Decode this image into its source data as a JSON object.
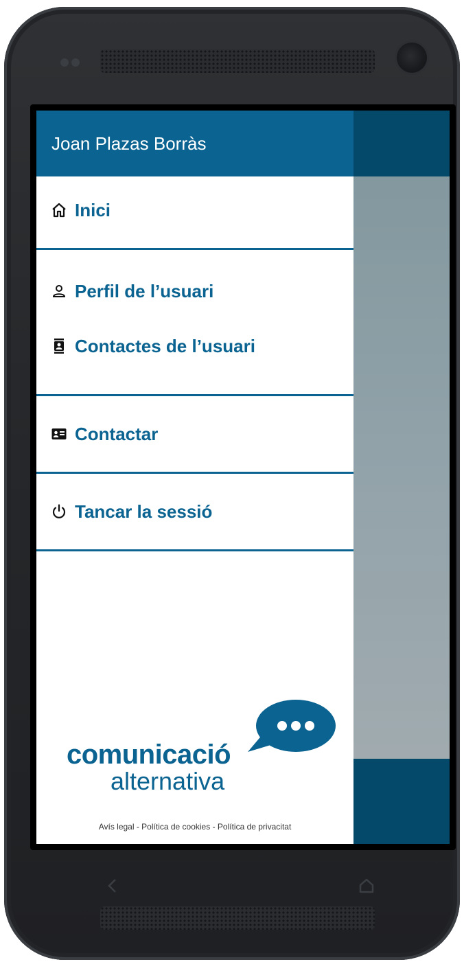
{
  "drawer": {
    "user_name": "Joan Plazas Borràs",
    "groups": [
      {
        "items": [
          {
            "label": "Inici",
            "icon": "home-icon"
          }
        ]
      },
      {
        "items": [
          {
            "label": "Perfil de l’usuari",
            "icon": "user-icon"
          },
          {
            "label": "Contactes de l’usuari",
            "icon": "contacts-icon"
          }
        ]
      },
      {
        "items": [
          {
            "label": "Contactar",
            "icon": "contact-card-icon"
          }
        ]
      },
      {
        "items": [
          {
            "label": "Tancar la sessió",
            "icon": "power-icon"
          }
        ]
      }
    ],
    "logo": {
      "line1": "comunicació",
      "line2": "alternativa"
    },
    "legal": "Avís legal - Política de cookies - Política de privacitat"
  },
  "colors": {
    "primary": "#0a6390",
    "dark": "#05496a",
    "scrim": "#8fa1a8"
  },
  "navbar": {
    "back_icon": "back-chevron-icon",
    "home_icon": "home-outline-icon"
  }
}
